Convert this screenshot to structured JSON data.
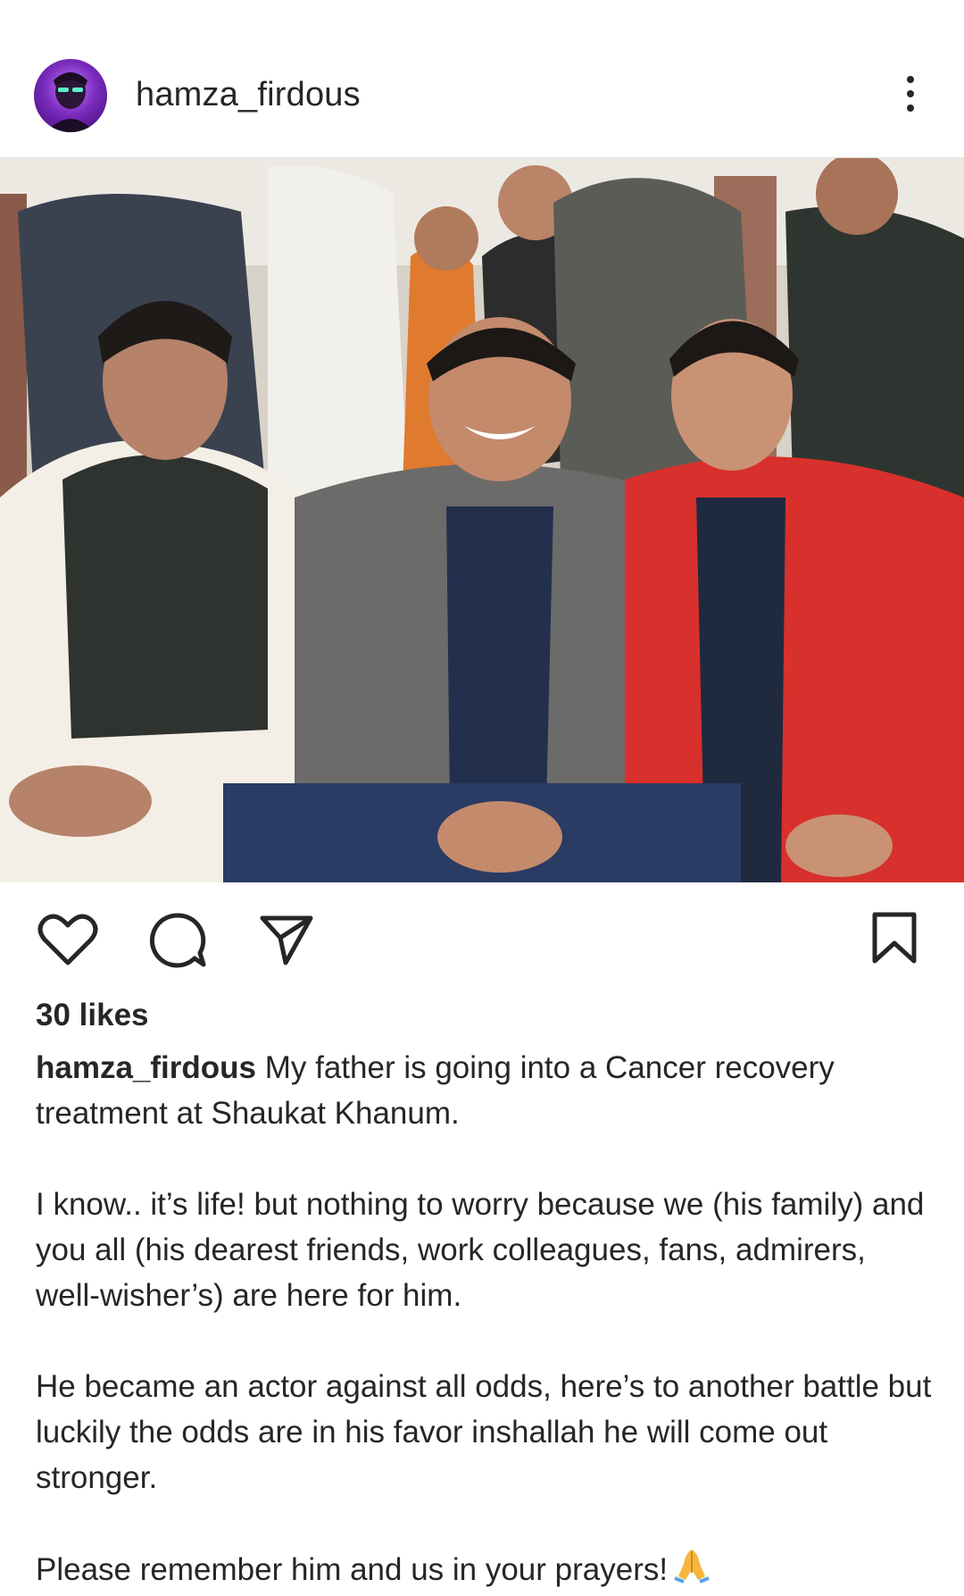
{
  "post": {
    "username": "hamza_firdous",
    "likes": "30 likes",
    "caption": {
      "username": "hamza_firdous",
      "p1": " My father is going into a Cancer recovery treatment at Shaukat Khanum.",
      "p2": "I know.. it’s life! but nothing to worry because we (his family) and you all (his dearest friends, work colleagues, fans, admirers, well-wisher’s) are here for him.",
      "p3": "He became an actor against all odds, here’s to another battle but luckily the odds are in his favor inshallah he will come out stronger.",
      "p4": "Please remember him and us in your prayers!",
      "emoji_name": "folded-hands-emoji"
    }
  },
  "icons": {
    "more": "more-options-icon",
    "like": "heart-icon",
    "comment": "comment-icon",
    "share": "send-icon",
    "save": "bookmark-icon"
  },
  "colors": {
    "text": "#262626",
    "avatar_ring": "#7b2cbf"
  }
}
